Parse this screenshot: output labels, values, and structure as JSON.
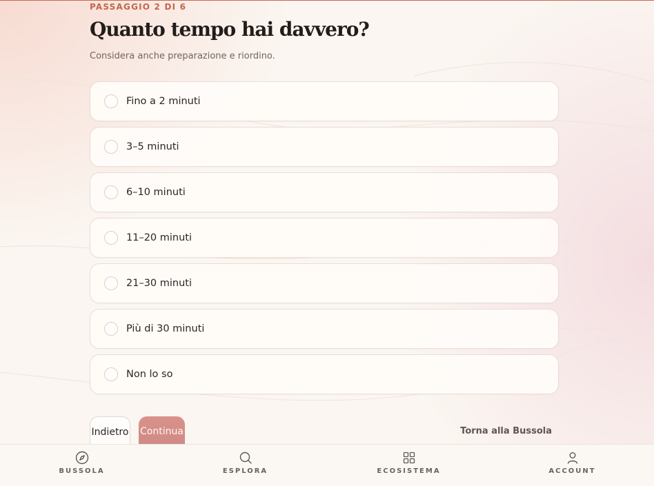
{
  "header": {
    "step": "PASSAGGIO 2 DI 6",
    "title": "Quanto tempo hai davvero?",
    "subtitle": "Considera anche preparazione e riordino."
  },
  "options": [
    {
      "label": "Fino a 2 minuti"
    },
    {
      "label": "3–5 minuti"
    },
    {
      "label": "6–10 minuti"
    },
    {
      "label": "11–20 minuti"
    },
    {
      "label": "21–30 minuti"
    },
    {
      "label": "Più di 30 minuti"
    },
    {
      "label": "Non lo so"
    }
  ],
  "actions": {
    "back_label": "Indietro",
    "continue_label": "Continua",
    "return_link": "Torna alla Bussola"
  },
  "nav": [
    {
      "label": "BUSSOLA",
      "icon": "compass-icon"
    },
    {
      "label": "ESPLORA",
      "icon": "search-icon"
    },
    {
      "label": "ECOSISTEMA",
      "icon": "grid-icon"
    },
    {
      "label": "ACCOUNT",
      "icon": "user-icon"
    }
  ],
  "colors": {
    "accent": "#c2664b",
    "continue_button": "#d9928a",
    "background": "#fbf6f1"
  }
}
